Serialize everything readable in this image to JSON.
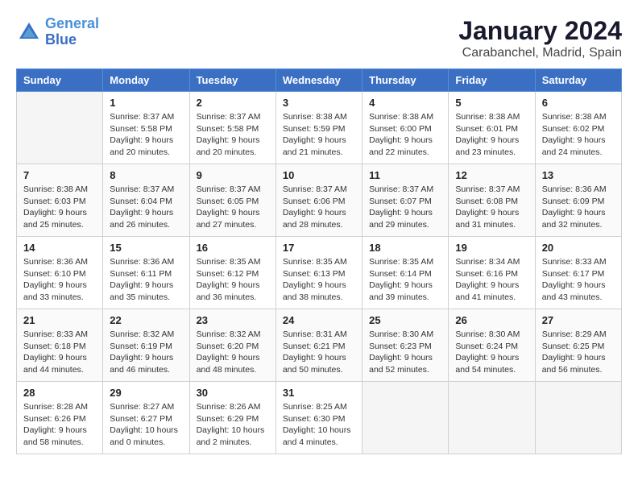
{
  "header": {
    "logo_line1": "General",
    "logo_line2": "Blue",
    "month_year": "January 2024",
    "location": "Carabanchel, Madrid, Spain"
  },
  "days_of_week": [
    "Sunday",
    "Monday",
    "Tuesday",
    "Wednesday",
    "Thursday",
    "Friday",
    "Saturday"
  ],
  "weeks": [
    [
      {
        "day": "",
        "empty": true
      },
      {
        "day": "1",
        "sunrise": "Sunrise: 8:37 AM",
        "sunset": "Sunset: 5:58 PM",
        "daylight": "Daylight: 9 hours and 20 minutes."
      },
      {
        "day": "2",
        "sunrise": "Sunrise: 8:37 AM",
        "sunset": "Sunset: 5:58 PM",
        "daylight": "Daylight: 9 hours and 20 minutes."
      },
      {
        "day": "3",
        "sunrise": "Sunrise: 8:38 AM",
        "sunset": "Sunset: 5:59 PM",
        "daylight": "Daylight: 9 hours and 21 minutes."
      },
      {
        "day": "4",
        "sunrise": "Sunrise: 8:38 AM",
        "sunset": "Sunset: 6:00 PM",
        "daylight": "Daylight: 9 hours and 22 minutes."
      },
      {
        "day": "5",
        "sunrise": "Sunrise: 8:38 AM",
        "sunset": "Sunset: 6:01 PM",
        "daylight": "Daylight: 9 hours and 23 minutes."
      },
      {
        "day": "6",
        "sunrise": "Sunrise: 8:38 AM",
        "sunset": "Sunset: 6:02 PM",
        "daylight": "Daylight: 9 hours and 24 minutes."
      }
    ],
    [
      {
        "day": "7",
        "sunrise": "Sunrise: 8:38 AM",
        "sunset": "Sunset: 6:03 PM",
        "daylight": "Daylight: 9 hours and 25 minutes."
      },
      {
        "day": "8",
        "sunrise": "Sunrise: 8:37 AM",
        "sunset": "Sunset: 6:04 PM",
        "daylight": "Daylight: 9 hours and 26 minutes."
      },
      {
        "day": "9",
        "sunrise": "Sunrise: 8:37 AM",
        "sunset": "Sunset: 6:05 PM",
        "daylight": "Daylight: 9 hours and 27 minutes."
      },
      {
        "day": "10",
        "sunrise": "Sunrise: 8:37 AM",
        "sunset": "Sunset: 6:06 PM",
        "daylight": "Daylight: 9 hours and 28 minutes."
      },
      {
        "day": "11",
        "sunrise": "Sunrise: 8:37 AM",
        "sunset": "Sunset: 6:07 PM",
        "daylight": "Daylight: 9 hours and 29 minutes."
      },
      {
        "day": "12",
        "sunrise": "Sunrise: 8:37 AM",
        "sunset": "Sunset: 6:08 PM",
        "daylight": "Daylight: 9 hours and 31 minutes."
      },
      {
        "day": "13",
        "sunrise": "Sunrise: 8:36 AM",
        "sunset": "Sunset: 6:09 PM",
        "daylight": "Daylight: 9 hours and 32 minutes."
      }
    ],
    [
      {
        "day": "14",
        "sunrise": "Sunrise: 8:36 AM",
        "sunset": "Sunset: 6:10 PM",
        "daylight": "Daylight: 9 hours and 33 minutes."
      },
      {
        "day": "15",
        "sunrise": "Sunrise: 8:36 AM",
        "sunset": "Sunset: 6:11 PM",
        "daylight": "Daylight: 9 hours and 35 minutes."
      },
      {
        "day": "16",
        "sunrise": "Sunrise: 8:35 AM",
        "sunset": "Sunset: 6:12 PM",
        "daylight": "Daylight: 9 hours and 36 minutes."
      },
      {
        "day": "17",
        "sunrise": "Sunrise: 8:35 AM",
        "sunset": "Sunset: 6:13 PM",
        "daylight": "Daylight: 9 hours and 38 minutes."
      },
      {
        "day": "18",
        "sunrise": "Sunrise: 8:35 AM",
        "sunset": "Sunset: 6:14 PM",
        "daylight": "Daylight: 9 hours and 39 minutes."
      },
      {
        "day": "19",
        "sunrise": "Sunrise: 8:34 AM",
        "sunset": "Sunset: 6:16 PM",
        "daylight": "Daylight: 9 hours and 41 minutes."
      },
      {
        "day": "20",
        "sunrise": "Sunrise: 8:33 AM",
        "sunset": "Sunset: 6:17 PM",
        "daylight": "Daylight: 9 hours and 43 minutes."
      }
    ],
    [
      {
        "day": "21",
        "sunrise": "Sunrise: 8:33 AM",
        "sunset": "Sunset: 6:18 PM",
        "daylight": "Daylight: 9 hours and 44 minutes."
      },
      {
        "day": "22",
        "sunrise": "Sunrise: 8:32 AM",
        "sunset": "Sunset: 6:19 PM",
        "daylight": "Daylight: 9 hours and 46 minutes."
      },
      {
        "day": "23",
        "sunrise": "Sunrise: 8:32 AM",
        "sunset": "Sunset: 6:20 PM",
        "daylight": "Daylight: 9 hours and 48 minutes."
      },
      {
        "day": "24",
        "sunrise": "Sunrise: 8:31 AM",
        "sunset": "Sunset: 6:21 PM",
        "daylight": "Daylight: 9 hours and 50 minutes."
      },
      {
        "day": "25",
        "sunrise": "Sunrise: 8:30 AM",
        "sunset": "Sunset: 6:23 PM",
        "daylight": "Daylight: 9 hours and 52 minutes."
      },
      {
        "day": "26",
        "sunrise": "Sunrise: 8:30 AM",
        "sunset": "Sunset: 6:24 PM",
        "daylight": "Daylight: 9 hours and 54 minutes."
      },
      {
        "day": "27",
        "sunrise": "Sunrise: 8:29 AM",
        "sunset": "Sunset: 6:25 PM",
        "daylight": "Daylight: 9 hours and 56 minutes."
      }
    ],
    [
      {
        "day": "28",
        "sunrise": "Sunrise: 8:28 AM",
        "sunset": "Sunset: 6:26 PM",
        "daylight": "Daylight: 9 hours and 58 minutes."
      },
      {
        "day": "29",
        "sunrise": "Sunrise: 8:27 AM",
        "sunset": "Sunset: 6:27 PM",
        "daylight": "Daylight: 10 hours and 0 minutes."
      },
      {
        "day": "30",
        "sunrise": "Sunrise: 8:26 AM",
        "sunset": "Sunset: 6:29 PM",
        "daylight": "Daylight: 10 hours and 2 minutes."
      },
      {
        "day": "31",
        "sunrise": "Sunrise: 8:25 AM",
        "sunset": "Sunset: 6:30 PM",
        "daylight": "Daylight: 10 hours and 4 minutes."
      },
      {
        "day": "",
        "empty": true
      },
      {
        "day": "",
        "empty": true
      },
      {
        "day": "",
        "empty": true
      }
    ]
  ]
}
